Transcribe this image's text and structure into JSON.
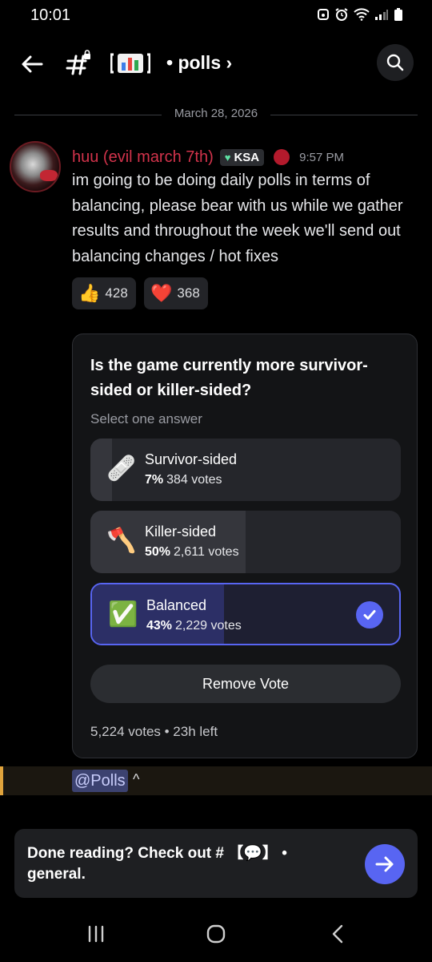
{
  "status_bar": {
    "time": "10:01"
  },
  "header": {
    "channel_emoji": "【📊】",
    "channel_name": "• polls ›"
  },
  "date_divider": "March 28, 2026",
  "message": {
    "username": "huu (evil march 7th)",
    "tag": "KSA",
    "timestamp": "9:57 PM",
    "text": "im going to be doing daily polls in terms of balancing, please bear with us while we gather results and throughout the week we'll send out balancing changes / hot fixes"
  },
  "reactions": [
    {
      "emoji": "👍",
      "count": "428"
    },
    {
      "emoji": "❤️",
      "count": "368"
    }
  ],
  "poll": {
    "question": "Is the game currently more survivor-sided or killer-sided?",
    "hint": "Select one answer",
    "answers": [
      {
        "emoji": "🩹",
        "label": "Survivor-sided",
        "percent": "7%",
        "votes": "384 votes",
        "fraction": 0.07,
        "selected": false
      },
      {
        "emoji": "🪓",
        "label": "Killer-sided",
        "percent": "50%",
        "votes": "2,611 votes",
        "fraction": 0.5,
        "selected": false
      },
      {
        "emoji": "✅",
        "label": "Balanced",
        "percent": "43%",
        "votes": "2,229 votes",
        "fraction": 0.43,
        "selected": true
      }
    ],
    "remove_vote_label": "Remove Vote",
    "footer": "5,224 votes • 23h left"
  },
  "mention": {
    "text": "@Polls",
    "caret": "^"
  },
  "cta": {
    "text": "Done reading? Check out # 【💬】 • general."
  },
  "colors": {
    "accent": "#5865f2",
    "username": "#d2334b",
    "background": "#000000"
  }
}
